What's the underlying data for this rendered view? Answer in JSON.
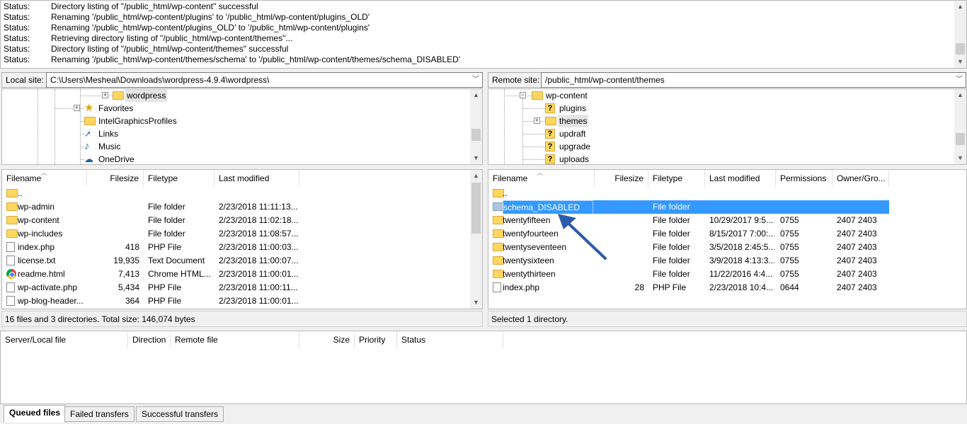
{
  "log": [
    {
      "label": "Status:",
      "text": "Directory listing of \"/public_html/wp-content\" successful"
    },
    {
      "label": "Status:",
      "text": "Renaming '/public_html/wp-content/plugins' to '/public_html/wp-content/plugins_OLD'"
    },
    {
      "label": "Status:",
      "text": "Renaming '/public_html/wp-content/plugins_OLD' to '/public_html/wp-content/plugins'"
    },
    {
      "label": "Status:",
      "text": "Retrieving directory listing of \"/public_html/wp-content/themes\"..."
    },
    {
      "label": "Status:",
      "text": "Directory listing of \"/public_html/wp-content/themes\" successful"
    },
    {
      "label": "Status:",
      "text": "Renaming '/public_html/wp-content/themes/schema' to '/public_html/wp-content/themes/schema_DISABLED'"
    }
  ],
  "local": {
    "site_label": "Local site:",
    "site_path": "C:\\Users\\Mesheal\\Downloads\\wordpress-4.9.4\\wordpress\\",
    "tree": [
      {
        "label": "wordpress",
        "icon": "folder-icon",
        "expander": "+"
      },
      {
        "label": "Favorites",
        "icon": "star-icon",
        "expander": "+"
      },
      {
        "label": "IntelGraphicsProfiles",
        "icon": "folder-icon",
        "expander": ""
      },
      {
        "label": "Links",
        "icon": "links-icon",
        "expander": ""
      },
      {
        "label": "Music",
        "icon": "music-note-icon",
        "expander": ""
      },
      {
        "label": "OneDrive",
        "icon": "cloud-icon",
        "expander": ""
      }
    ],
    "columns": [
      "Filename",
      "Filesize",
      "Filetype",
      "Last modified"
    ],
    "files": [
      {
        "name": "..",
        "size": "",
        "type": "",
        "modified": "",
        "icon": "folder-icon"
      },
      {
        "name": "wp-admin",
        "size": "",
        "type": "File folder",
        "modified": "2/23/2018 11:11:13...",
        "icon": "folder-icon"
      },
      {
        "name": "wp-content",
        "size": "",
        "type": "File folder",
        "modified": "2/23/2018 11:02:18...",
        "icon": "folder-icon"
      },
      {
        "name": "wp-includes",
        "size": "",
        "type": "File folder",
        "modified": "2/23/2018 11:08:57...",
        "icon": "folder-icon"
      },
      {
        "name": "index.php",
        "size": "418",
        "type": "PHP File",
        "modified": "2/23/2018 11:00:03...",
        "icon": "file-icon"
      },
      {
        "name": "license.txt",
        "size": "19,935",
        "type": "Text Document",
        "modified": "2/23/2018 11:00:07...",
        "icon": "file-icon"
      },
      {
        "name": "readme.html",
        "size": "7,413",
        "type": "Chrome HTML...",
        "modified": "2/23/2018 11:00:01...",
        "icon": "chrome-icon"
      },
      {
        "name": "wp-activate.php",
        "size": "5,434",
        "type": "PHP File",
        "modified": "2/23/2018 11:00:11...",
        "icon": "file-icon"
      },
      {
        "name": "wp-blog-header...",
        "size": "364",
        "type": "PHP File",
        "modified": "2/23/2018 11:00:01...",
        "icon": "file-icon"
      }
    ],
    "status": "16 files and 3 directories. Total size: 146,074 bytes"
  },
  "remote": {
    "site_label": "Remote site:",
    "site_path": "/public_html/wp-content/themes",
    "tree": [
      {
        "label": "wp-content",
        "icon": "folder-icon",
        "expander": "−"
      },
      {
        "label": "plugins",
        "icon": "unknown-folder-icon",
        "expander": ""
      },
      {
        "label": "themes",
        "icon": "folder-icon",
        "expander": "+"
      },
      {
        "label": "updraft",
        "icon": "unknown-folder-icon",
        "expander": ""
      },
      {
        "label": "upgrade",
        "icon": "unknown-folder-icon",
        "expander": ""
      },
      {
        "label": "uploads",
        "icon": "unknown-folder-icon",
        "expander": ""
      }
    ],
    "columns": [
      "Filename",
      "Filesize",
      "Filetype",
      "Last modified",
      "Permissions",
      "Owner/Gro..."
    ],
    "files": [
      {
        "name": "..",
        "size": "",
        "type": "",
        "modified": "",
        "perm": "",
        "owner": "",
        "icon": "folder-icon"
      },
      {
        "name": "schema_DISABLED",
        "size": "",
        "type": "File folder",
        "modified": "",
        "perm": "",
        "owner": "",
        "icon": "folder-icon",
        "selected": true
      },
      {
        "name": "twentyfifteen",
        "size": "",
        "type": "File folder",
        "modified": "10/29/2017 9:5...",
        "perm": "0755",
        "owner": "2407 2403",
        "icon": "folder-icon"
      },
      {
        "name": "twentyfourteen",
        "size": "",
        "type": "File folder",
        "modified": "8/15/2017 7:00:...",
        "perm": "0755",
        "owner": "2407 2403",
        "icon": "folder-icon"
      },
      {
        "name": "twentyseventeen",
        "size": "",
        "type": "File folder",
        "modified": "3/5/2018 2:45:5...",
        "perm": "0755",
        "owner": "2407 2403",
        "icon": "folder-icon"
      },
      {
        "name": "twentysixteen",
        "size": "",
        "type": "File folder",
        "modified": "3/9/2018 4:13:3...",
        "perm": "0755",
        "owner": "2407 2403",
        "icon": "folder-icon"
      },
      {
        "name": "twentythirteen",
        "size": "",
        "type": "File folder",
        "modified": "11/22/2016 4:4...",
        "perm": "0755",
        "owner": "2407 2403",
        "icon": "folder-icon"
      },
      {
        "name": "index.php",
        "size": "28",
        "type": "PHP File",
        "modified": "2/23/2018 10:4...",
        "perm": "0644",
        "owner": "2407 2403",
        "icon": "file-icon"
      }
    ],
    "status": "Selected 1 directory."
  },
  "queue": {
    "columns": [
      "Server/Local file",
      "Direction",
      "Remote file",
      "Size",
      "Priority",
      "Status"
    ]
  },
  "tabs": [
    {
      "label": "Queued files",
      "active": true
    },
    {
      "label": "Failed transfers",
      "active": false
    },
    {
      "label": "Successful transfers",
      "active": false
    }
  ],
  "colors": {
    "selection": "#3399ff",
    "folder": "#ffd75e",
    "annotation_arrow": "#2a5caa"
  }
}
